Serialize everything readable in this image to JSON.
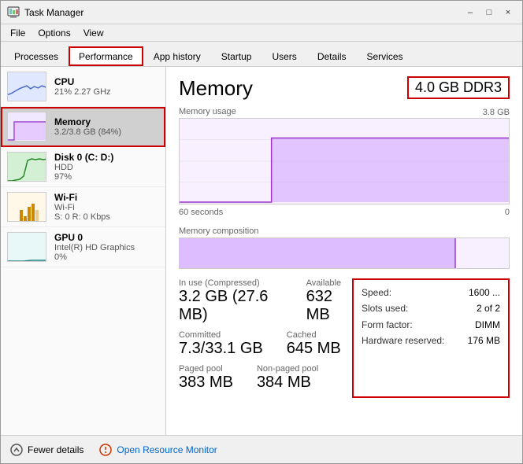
{
  "window": {
    "title": "Task Manager",
    "controls": {
      "minimize": "–",
      "maximize": "□",
      "close": "×"
    }
  },
  "menu": {
    "items": [
      "File",
      "Options",
      "View"
    ]
  },
  "tabs": [
    {
      "id": "processes",
      "label": "Processes",
      "active": false
    },
    {
      "id": "performance",
      "label": "Performance",
      "active": true
    },
    {
      "id": "app-history",
      "label": "App history",
      "active": false
    },
    {
      "id": "startup",
      "label": "Startup",
      "active": false
    },
    {
      "id": "users",
      "label": "Users",
      "active": false
    },
    {
      "id": "details",
      "label": "Details",
      "active": false
    },
    {
      "id": "services",
      "label": "Services",
      "active": false
    }
  ],
  "sidebar": {
    "items": [
      {
        "id": "cpu",
        "label": "CPU",
        "stat1": "21% 2.27 GHz",
        "active": false
      },
      {
        "id": "memory",
        "label": "Memory",
        "stat1": "3.2/3.8 GB (84%)",
        "active": true
      },
      {
        "id": "disk0",
        "label": "Disk 0 (C: D:)",
        "stat1": "HDD",
        "stat2": "97%",
        "active": false
      },
      {
        "id": "wifi",
        "label": "Wi-Fi",
        "stat1": "Wi-Fi",
        "stat2": "S: 0 R: 0 Kbps",
        "active": false
      },
      {
        "id": "gpu0",
        "label": "GPU 0",
        "stat1": "Intel(R) HD Graphics",
        "stat2": "0%",
        "active": false
      }
    ]
  },
  "main": {
    "title": "Memory",
    "memory_type": "4.0 GB DDR3",
    "usage_chart": {
      "label": "Memory usage",
      "right_label": "3.8 GB",
      "time_left": "60 seconds",
      "time_right": "0"
    },
    "composition_label": "Memory composition",
    "stats": [
      {
        "label": "In use (Compressed)",
        "value": "3.2 GB (27.6 MB)"
      },
      {
        "label": "Available",
        "value": "632 MB"
      },
      {
        "label": "Committed",
        "value": "7.3/33.1 GB"
      },
      {
        "label": "Cached",
        "value": "645 MB"
      },
      {
        "label": "Paged pool",
        "value": "383 MB"
      },
      {
        "label": "Non-paged pool",
        "value": "384 MB"
      }
    ],
    "info": {
      "speed_label": "Speed:",
      "speed_value": "1600 ...",
      "slots_label": "Slots used:",
      "slots_value": "2 of 2",
      "form_label": "Form factor:",
      "form_value": "DIMM",
      "reserved_label": "Hardware reserved:",
      "reserved_value": "176 MB"
    }
  },
  "bottom": {
    "fewer_details": "Fewer details",
    "open_monitor": "Open Resource Monitor"
  }
}
